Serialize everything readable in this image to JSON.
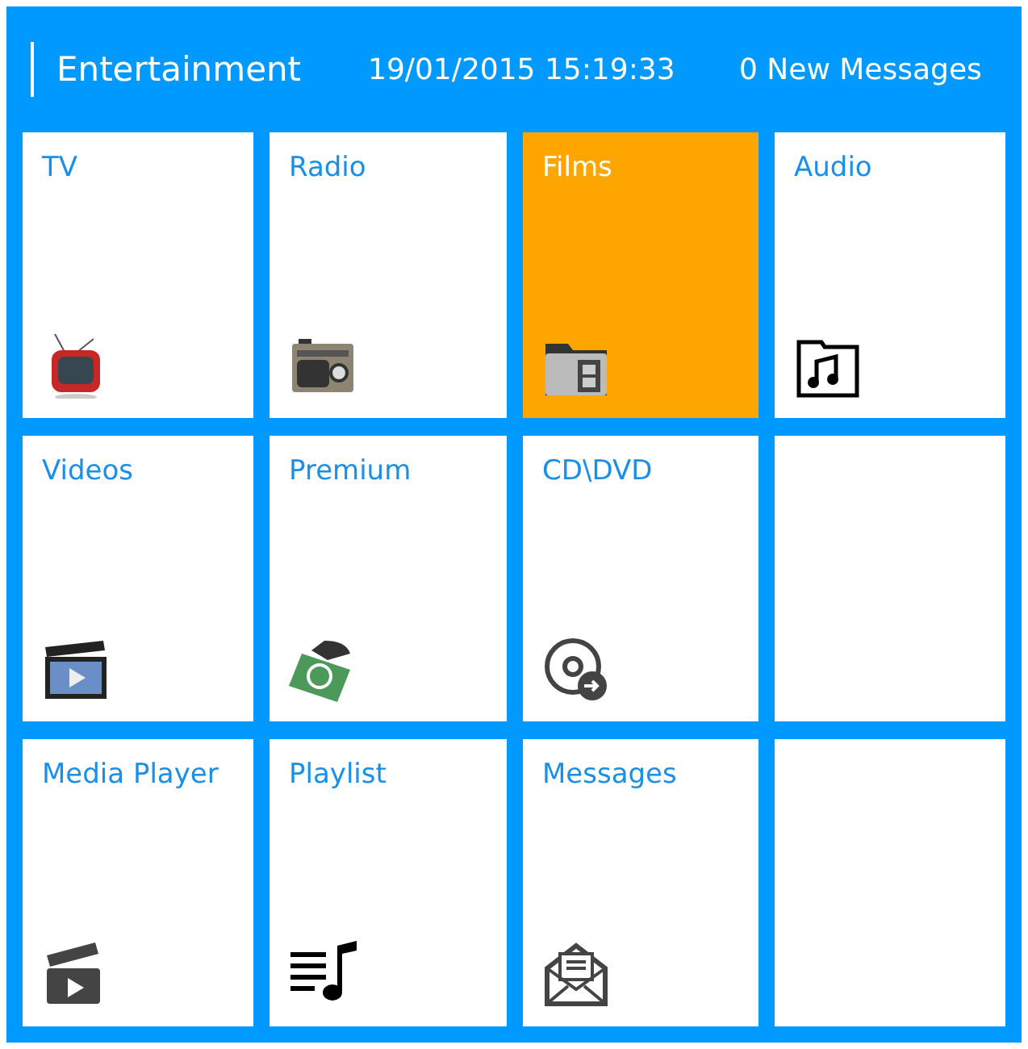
{
  "header": {
    "title": "Entertainment",
    "datetime": "19/01/2015 15:19:33",
    "messages": "0 New Messages"
  },
  "tiles": [
    {
      "label": "TV",
      "selected": false
    },
    {
      "label": "Radio",
      "selected": false
    },
    {
      "label": "Films",
      "selected": true
    },
    {
      "label": "Audio",
      "selected": false
    },
    {
      "label": "Videos",
      "selected": false
    },
    {
      "label": "Premium",
      "selected": false
    },
    {
      "label": "CD\\DVD",
      "selected": false
    },
    {
      "selected": false
    },
    {
      "label": "Media Player",
      "selected": false
    },
    {
      "label": "Playlist",
      "selected": false
    },
    {
      "label": "Messages",
      "selected": false
    },
    {
      "selected": false
    }
  ]
}
